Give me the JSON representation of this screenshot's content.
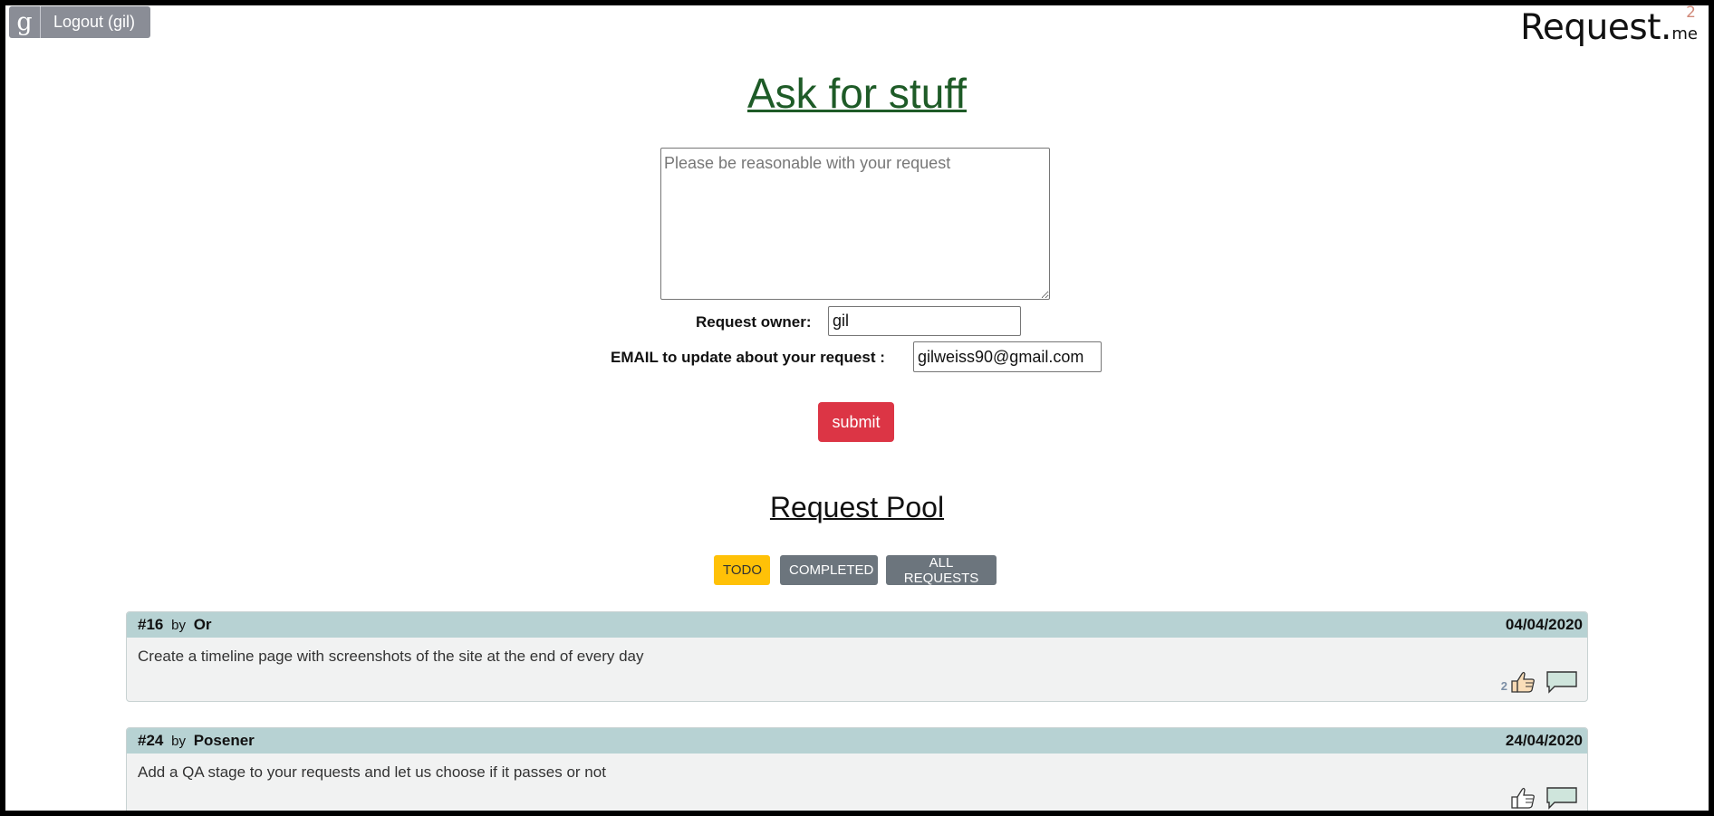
{
  "header": {
    "google_letter": "g",
    "logout_label": "Logout (gil)",
    "brand_main": "Request",
    "brand_dot": ".",
    "brand_me": "me",
    "brand_sup": "2"
  },
  "form": {
    "title": "Ask for stuff",
    "request_placeholder": "Please be reasonable with your request",
    "owner_label": "Request owner:",
    "owner_value": "gil",
    "email_label": "EMAIL to update about your request :",
    "email_value": "gilweiss90@gmail.com",
    "submit_label": "submit"
  },
  "pool": {
    "title": "Request Pool",
    "filters": {
      "todo": "TODO",
      "completed": "COMPLETED",
      "all": "ALL REQUESTS"
    },
    "requests": [
      {
        "id": "#16",
        "by": "by",
        "author": "Or",
        "date": "04/04/2020",
        "text": "Create a timeline page with screenshots of the site at the end of every day",
        "likes": "2"
      },
      {
        "id": "#24",
        "by": "by",
        "author": "Posener",
        "date": "24/04/2020",
        "text": "Add a QA stage to your requests and let us choose if it passes or not",
        "likes": ""
      }
    ]
  },
  "colors": {
    "title_green": "#1e5b27",
    "submit_red": "#dc3545",
    "todo_yellow": "#ffc107",
    "filter_gray": "#6c757d",
    "card_header": "#b7d2d3"
  },
  "icons": {
    "like": "thumbs-up-icon",
    "comment": "speech-bubble-icon"
  }
}
